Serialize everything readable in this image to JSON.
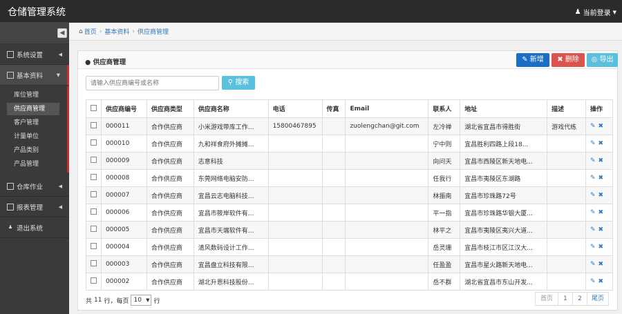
{
  "app": {
    "title": "仓储管理系统",
    "user_label": "当前登录"
  },
  "sidebar": {
    "items": [
      {
        "label": "系统设置"
      },
      {
        "label": "基本资料"
      },
      {
        "label": "仓库作业"
      },
      {
        "label": "报表管理"
      },
      {
        "label": "退出系统"
      }
    ],
    "sub_items": [
      "库位管理",
      "供应商管理",
      "客户管理",
      "计量单位",
      "产品类别",
      "产品管理"
    ],
    "active_sub": "供应商管理"
  },
  "breadcrumb": {
    "home": "首页",
    "level1": "基本资料",
    "level2": "供应商管理"
  },
  "panel": {
    "title": "供应商管理",
    "new_label": "新增",
    "delete_label": "删除",
    "export_label": "导出"
  },
  "search": {
    "placeholder": "请输入供应商编号或名称",
    "button_label": "搜索"
  },
  "table": {
    "headers": [
      "供应商编号",
      "供应商类型",
      "供应商名称",
      "电话",
      "传真",
      "Email",
      "联系人",
      "地址",
      "描述",
      "操作"
    ],
    "rows": [
      [
        "000011",
        "合作供应商",
        "小米游戏带库工作...",
        "15800467895",
        "",
        "zuolengchan@git.com",
        "左冷禅",
        "湖北省宜昌市得胜街",
        "游戏代练"
      ],
      [
        "000010",
        "合作供应商",
        "九和祥食府外摊摊...",
        "",
        "",
        "",
        "宁中则",
        "宜昌胜利四路上段18...",
        ""
      ],
      [
        "000009",
        "合作供应商",
        "志意科技",
        "",
        "",
        "",
        "向问天",
        "宜昌市西陵区新天地电...",
        ""
      ],
      [
        "000008",
        "合作供应商",
        "东莞网络电脑安防...",
        "",
        "",
        "",
        "任我行",
        "宜昌市夷陵区东湖路",
        ""
      ],
      [
        "000007",
        "合作供应商",
        "宜昌云志电脑科技...",
        "",
        "",
        "",
        "林振南",
        "宜昌市珍珠路72号",
        ""
      ],
      [
        "000006",
        "合作供应商",
        "宜昌市筱岸软件有...",
        "",
        "",
        "",
        "平一指",
        "宜昌市珍珠路华银大厦...",
        ""
      ],
      [
        "000005",
        "合作供应商",
        "宜昌市天端软件有...",
        "",
        "",
        "",
        "林平之",
        "宜昌市夷陵区夷兴大道...",
        ""
      ],
      [
        "000004",
        "合作供应商",
        "清风数码设计工作...",
        "",
        "",
        "",
        "岳灵珊",
        "宜昌市枝江市区江汉大...",
        ""
      ],
      [
        "000003",
        "合作供应商",
        "宜昌盘立科技有限...",
        "",
        "",
        "",
        "任盈盈",
        "宜昌市星火路新天地电...",
        ""
      ],
      [
        "000002",
        "合作供应商",
        "湖北升恩科技股份...",
        "",
        "",
        "",
        "岳不群",
        "湖北省宜昌市东山开发...",
        ""
      ]
    ]
  },
  "footer": {
    "total_prefix": "共",
    "total_count": "11",
    "total_mid": "行，每页",
    "page_size": "10",
    "row_suffix": "行",
    "first_label": "首页",
    "pages": [
      "1",
      "2"
    ],
    "last_label": "尾页"
  }
}
